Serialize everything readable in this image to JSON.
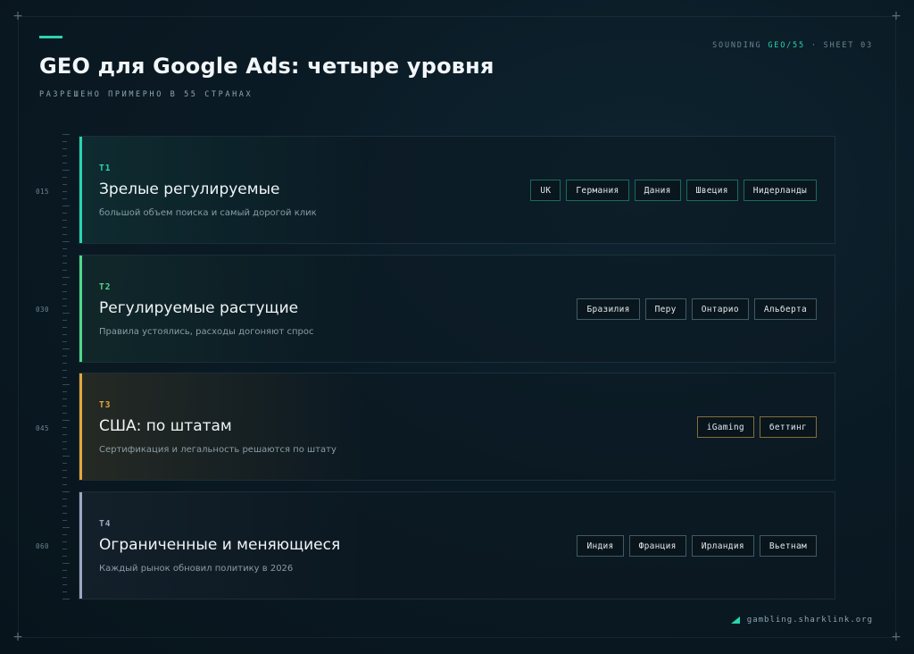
{
  "header": {
    "title": "GEO для Google Ads: четыре уровня",
    "subtitle": "РАЗРЕШЕНО ПРИМЕРНО В 55 СТРАНАХ",
    "sheet_prefix": "SOUNDING ",
    "sheet_highlight": "GEO/55",
    "sheet_suffix": " · SHEET 03"
  },
  "ruler_labels": [
    "015",
    "030",
    "045",
    "060"
  ],
  "tiers": [
    {
      "code": "T1",
      "name": "Зрелые регулируемые",
      "description": "большой объем поиска и самый дорогой клик",
      "color": "#2ad4b0",
      "tags": [
        "UK",
        "Германия",
        "Дания",
        "Швеция",
        "Нидерланды"
      ]
    },
    {
      "code": "T2",
      "name": "Регулируемые растущие",
      "description": "Правила устоялись, расходы догоняют спрос",
      "color": "#4fd88a",
      "tags": [
        "Бразилия",
        "Перу",
        "Онтарио",
        "Альберта"
      ]
    },
    {
      "code": "T3",
      "name": "США: по штатам",
      "description": "Сертификация и легальность решаются по штату",
      "color": "#e0a83c",
      "tags": [
        "iGaming",
        "беттинг"
      ]
    },
    {
      "code": "T4",
      "name": "Ограниченные и меняющиеся",
      "description": "Каждый рынок обновил политику в 2026",
      "color": "#9aa8c0",
      "tags": [
        "Индия",
        "Франция",
        "Ирландия",
        "Вьетнам"
      ]
    }
  ],
  "footer": {
    "domain": "gambling.sharklink.org"
  }
}
